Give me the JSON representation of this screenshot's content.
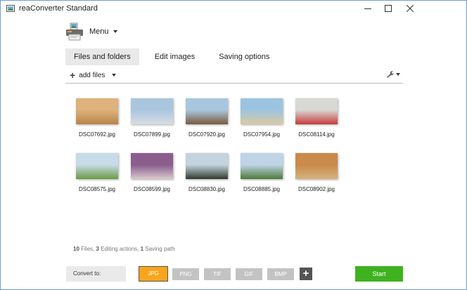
{
  "window": {
    "title": "reaConverter Standard"
  },
  "menu": {
    "label": "Menu"
  },
  "tabs": [
    {
      "label": "Files and folders",
      "active": true
    },
    {
      "label": "Edit images",
      "active": false
    },
    {
      "label": "Saving options",
      "active": false
    }
  ],
  "toolbar": {
    "add_files_label": "add files"
  },
  "files": [
    {
      "name": "DSC07692.jpg",
      "colors": [
        "#ddb27c",
        "#b8844a"
      ]
    },
    {
      "name": "DSC07899.jpg",
      "colors": [
        "#a9c6de",
        "#d8dde2"
      ]
    },
    {
      "name": "DSC07920.jpg",
      "colors": [
        "#a8c7de",
        "#7b5a40"
      ]
    },
    {
      "name": "DSC07954.jpg",
      "colors": [
        "#9cc4e0",
        "#dcc9a3"
      ]
    },
    {
      "name": "DSC08114.jpg",
      "colors": [
        "#d8d8d4",
        "#c73a3a"
      ]
    },
    {
      "name": "DSC08575.jpg",
      "colors": [
        "#c7dce8",
        "#6c9a44"
      ]
    },
    {
      "name": "DSC08599.jpg",
      "colors": [
        "#8a5d8d",
        "#d9c8cc"
      ]
    },
    {
      "name": "DSC08830.jpg",
      "colors": [
        "#c3d4de",
        "#2f3a2c"
      ]
    },
    {
      "name": "DSC08885.jpg",
      "colors": [
        "#bfd4e6",
        "#4d7a3a"
      ]
    },
    {
      "name": "DSC08902.jpg",
      "colors": [
        "#c98a4a",
        "#d4b27e"
      ]
    }
  ],
  "status": {
    "files_count": "10",
    "files_label": " Files, ",
    "edit_count": "3",
    "edit_label": " Editing actions, ",
    "save_count": "1",
    "save_label": " Saving path"
  },
  "convert": {
    "label": "Convert to:",
    "formats": [
      {
        "label": "JPG",
        "active": true
      },
      {
        "label": "PNG",
        "active": false
      },
      {
        "label": "TIF",
        "active": false
      },
      {
        "label": "GIF",
        "active": false
      },
      {
        "label": "BMP",
        "active": false
      }
    ],
    "add_label": "+",
    "start_label": "Start"
  },
  "colors": {
    "accent": "#f9a51c",
    "start": "#3fb21f",
    "window_border": "#6f9bd1"
  },
  "icons": [
    "app-icon",
    "minimize-icon",
    "maximize-icon",
    "close-icon",
    "menu-printer-icon",
    "chevron-down-icon",
    "plus-icon",
    "wrench-icon"
  ]
}
